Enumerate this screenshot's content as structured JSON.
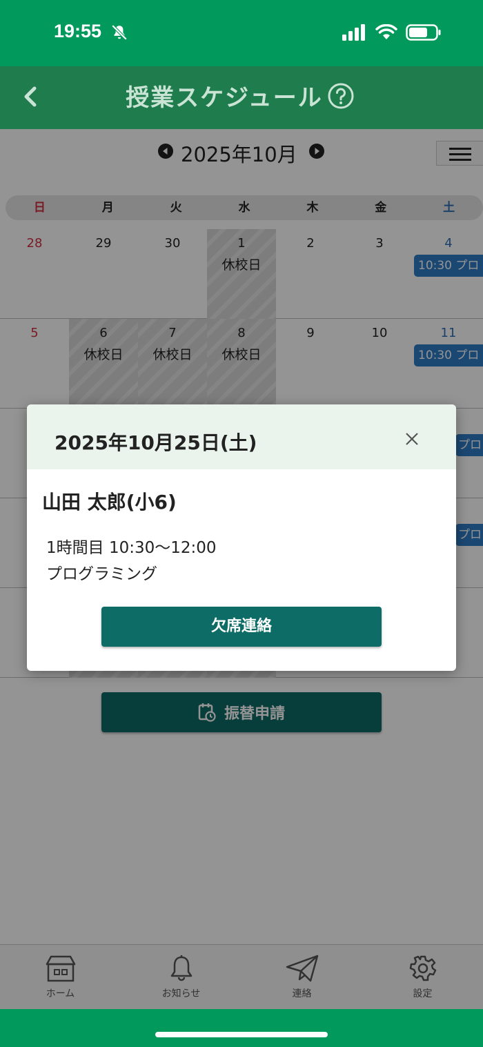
{
  "status_bar": {
    "time": "19:55"
  },
  "header": {
    "title": "授業スケジュール"
  },
  "calendar": {
    "month_title": "2025年10月",
    "weekdays": [
      "日",
      "月",
      "火",
      "水",
      "木",
      "金",
      "土"
    ],
    "weeks": [
      {
        "days": [
          {
            "num": "28",
            "note": ""
          },
          {
            "num": "29",
            "note": ""
          },
          {
            "num": "30",
            "note": ""
          },
          {
            "num": "1",
            "note": "休校日"
          },
          {
            "num": "2",
            "note": ""
          },
          {
            "num": "3",
            "note": ""
          },
          {
            "num": "4",
            "note": ""
          }
        ],
        "event": "10:30 プロ"
      },
      {
        "days": [
          {
            "num": "5",
            "note": ""
          },
          {
            "num": "6",
            "note": "休校日"
          },
          {
            "num": "7",
            "note": "休校日"
          },
          {
            "num": "8",
            "note": "休校日"
          },
          {
            "num": "9",
            "note": ""
          },
          {
            "num": "10",
            "note": ""
          },
          {
            "num": "11",
            "note": ""
          }
        ],
        "event": "10:30 プロ"
      },
      {
        "event": "プロ"
      },
      {
        "event": "プロ"
      }
    ]
  },
  "transfer_button": {
    "label": "振替申請"
  },
  "modal": {
    "date": "2025年10月25日(土)",
    "student": "山田 太郎(小6)",
    "time": "1時間目 10:30〜12:00",
    "subject": "プログラミング",
    "absence_button": "欠席連絡"
  },
  "tabbar": {
    "home": "ホーム",
    "notice": "お知らせ",
    "contact": "連絡",
    "settings": "設定"
  },
  "colors": {
    "status_green": "#029a5c",
    "header_green": "#1f7c4c",
    "button_teal": "#0d6c66",
    "event_blue": "#2f7dc6",
    "sunday_red": "#d03040",
    "saturday_blue": "#2f6fb5"
  }
}
